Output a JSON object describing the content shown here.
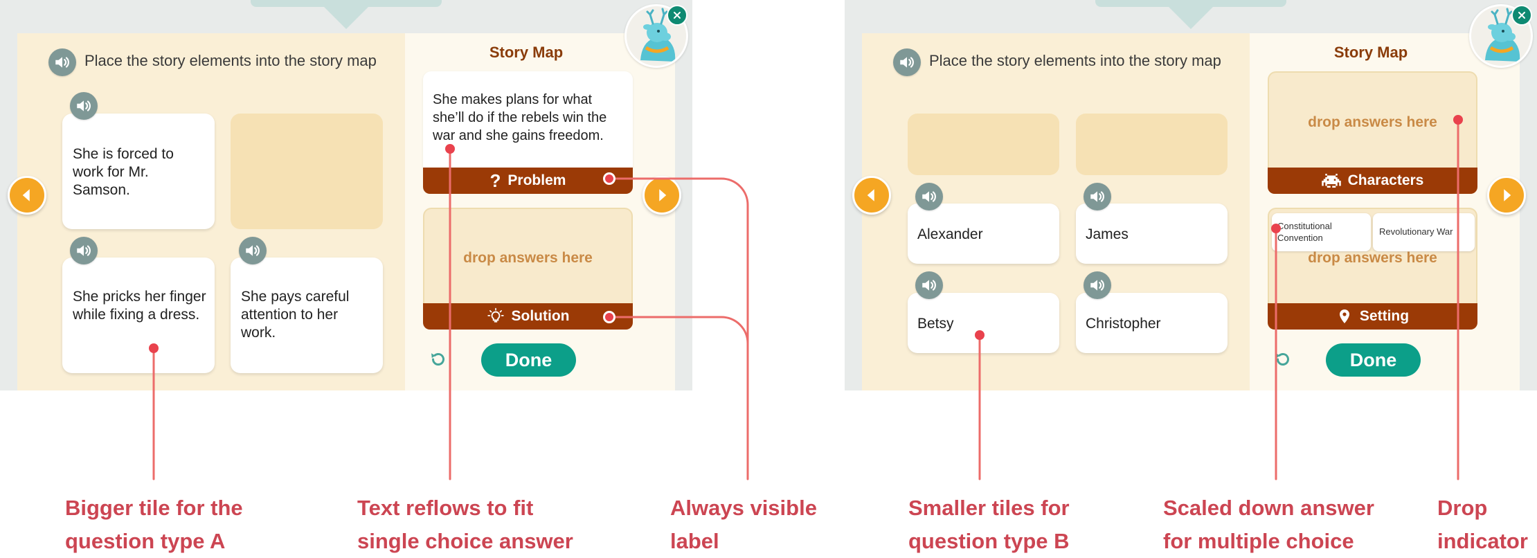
{
  "colors": {
    "accent_orange": "#f5a623",
    "done_green": "#0c9f89",
    "card_bar_brown": "#9b3a06",
    "drop_text": "#c98a46",
    "annotation_red": "#cc4552",
    "indicator_red": "#e9424d"
  },
  "icons": {
    "speaker": "speaker-icon",
    "prev": "chevron-left-icon",
    "next": "chevron-right-icon",
    "reset": "reset-icon",
    "close": "close-icon",
    "problem": "question-icon",
    "solution": "lightbulb-icon",
    "characters": "invader-icon",
    "setting": "location-pin-icon"
  },
  "left_screen": {
    "instruction": "Place the story elements into the story map",
    "tiles": [
      "She is forced to work for Mr. Samson.",
      "She pricks her finger while fixing a dress.",
      "She pays careful attention to her work."
    ],
    "story_map": {
      "title": "Story Map",
      "card1_text": "She makes plans for what she’ll do if the rebels win the war and she gains freedom.",
      "card1_label": "Problem",
      "card2_drop": "drop answers here",
      "card2_label": "Solution"
    },
    "done_label": "Done"
  },
  "right_screen": {
    "instruction": "Place the story elements into the story map",
    "tiles": [
      "Alexander",
      "James",
      "Betsy",
      "Christopher"
    ],
    "story_map": {
      "title": "Story Map",
      "card1_drop": "drop answers here",
      "card1_label": "Characters",
      "chips": [
        "Constitutional Convention",
        "Revolutionary War"
      ],
      "card2_drop": "drop answers here",
      "card2_label": "Setting"
    },
    "done_label": "Done"
  },
  "annotations": [
    {
      "line1": "Bigger tile for the",
      "line2": "question type A"
    },
    {
      "line1": "Text reflows to fit",
      "line2": "single choice answer"
    },
    {
      "line1": "Always visible",
      "line2": "label"
    },
    {
      "line1": "Smaller tiles for",
      "line2": "question type B"
    },
    {
      "line1": "Scaled down answer",
      "line2": "for multiple choice"
    },
    {
      "line1": "Drop",
      "line2": "indicator"
    }
  ]
}
